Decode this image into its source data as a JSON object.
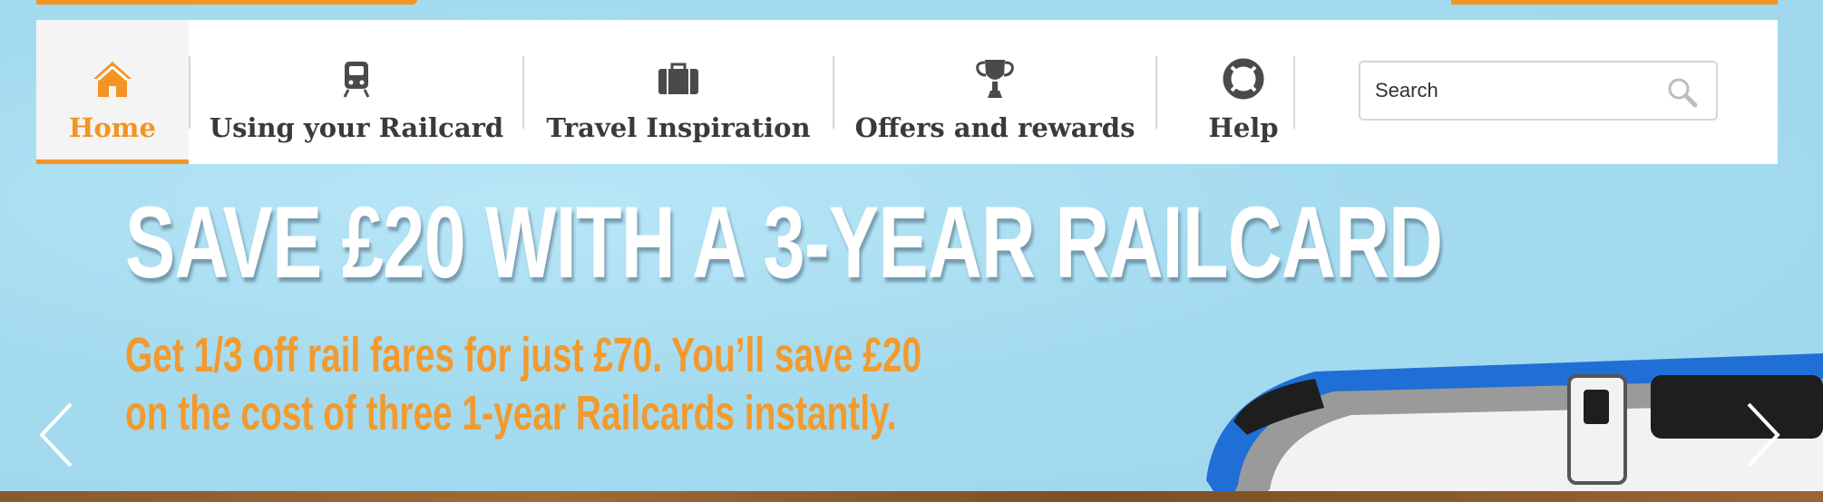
{
  "nav": {
    "items": [
      {
        "label": "Home",
        "icon": "home-icon",
        "active": true
      },
      {
        "label": "Using your Railcard",
        "icon": "train-icon",
        "active": false
      },
      {
        "label": "Travel Inspiration",
        "icon": "suitcase-icon",
        "active": false
      },
      {
        "label": "Offers and rewards",
        "icon": "trophy-icon",
        "active": false
      },
      {
        "label": "Help",
        "icon": "lifebuoy-icon",
        "active": false
      }
    ]
  },
  "search": {
    "placeholder": "Search",
    "icon": "search-icon"
  },
  "banner": {
    "headline": "SAVE £20 WITH A 3-YEAR RAILCARD",
    "subtext_line1": "Get 1/3 off rail fares for just £70.  You’ll save £20",
    "subtext_line2": "on the cost of three 1-year Railcards instantly.",
    "prev_icon": "chevron-left-icon",
    "next_icon": "chevron-right-icon"
  },
  "colors": {
    "accent": "#f39423",
    "sky": "#a9dcef",
    "nav_text": "#3a3a3a",
    "headline": "#ffffff",
    "subtext": "#f29a2e",
    "train_blue": "#1f6fd6"
  }
}
